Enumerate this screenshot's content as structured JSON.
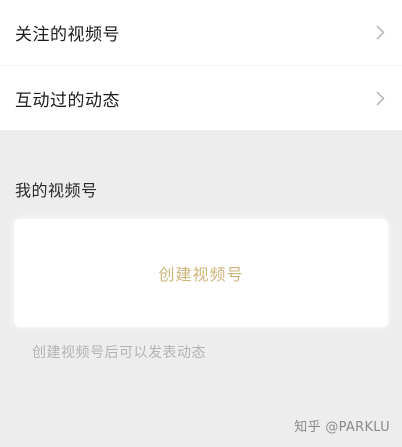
{
  "menu": {
    "items": [
      {
        "label": "关注的视频号"
      },
      {
        "label": "互动过的动态"
      }
    ]
  },
  "my_channel": {
    "section_title": "我的视频号",
    "create_label": "创建视频号",
    "hint": "创建视频号后可以发表动态"
  },
  "watermark": "知乎 @PARKLU",
  "icons": {
    "chevron": "chevron-right-icon"
  },
  "colors": {
    "background": "#ededed",
    "card": "#ffffff",
    "create_text": "#cdb57a",
    "hint_text": "#b3b3b3",
    "chevron": "#b8b8b8"
  }
}
